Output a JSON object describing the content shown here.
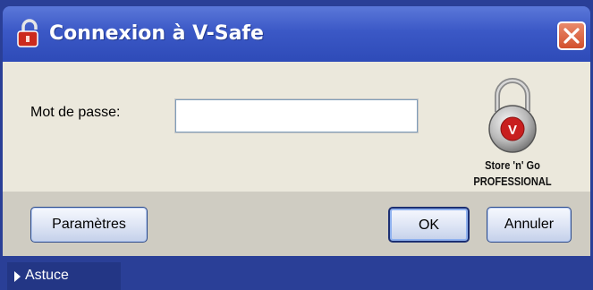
{
  "window": {
    "title": "Connexion à V-Safe",
    "title_icon": "lock-icon",
    "close_icon": "close-icon"
  },
  "form": {
    "password_label": "Mot de passe:",
    "password_value": "",
    "password_placeholder": ""
  },
  "brand": {
    "line1": "Store 'n' Go",
    "line2": "PROFESSIONAL",
    "logo_letter": "V",
    "icon": "padlock-icon"
  },
  "buttons": {
    "settings_label": "Paramètres",
    "ok_label": "OK",
    "cancel_label": "Annuler"
  },
  "tip": {
    "label": "Astuce",
    "icon": "triangle-right-icon"
  },
  "colors": {
    "title_bar": "#3b58c6",
    "close_button": "#d2502d",
    "content_bg": "#ebe8dc",
    "button_bar": "#cfccc2",
    "footer": "#2a3f97"
  }
}
